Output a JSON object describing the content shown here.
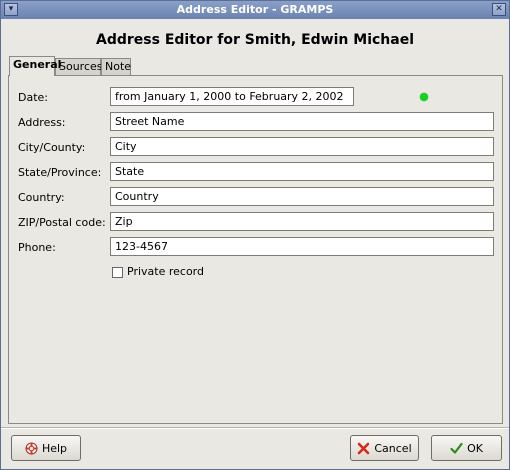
{
  "window": {
    "title": "Address Editor - GRAMPS"
  },
  "heading": "Address Editor for Smith, Edwin Michael",
  "tabs": [
    {
      "label": "General"
    },
    {
      "label": "Sources"
    },
    {
      "label": "Note"
    }
  ],
  "form": {
    "date": {
      "label": "Date:",
      "value": "from  January 1, 2000 to February 2, 2002"
    },
    "address": {
      "label": "Address:",
      "value": "Street Name"
    },
    "city": {
      "label": "City/County:",
      "value": "City"
    },
    "state": {
      "label": "State/Province:",
      "value": "State"
    },
    "country": {
      "label": "Country:",
      "value": "Country"
    },
    "zip": {
      "label": "ZIP/Postal code:",
      "value": "Zip"
    },
    "phone": {
      "label": "Phone:",
      "value": "123-4567"
    },
    "private_record": {
      "label": "Private record",
      "checked": false
    }
  },
  "status": {
    "date_valid_color": "#13d41a"
  },
  "buttons": {
    "help": "Help",
    "cancel": "Cancel",
    "ok": "OK"
  },
  "icons": {
    "help": "lifebuoy-icon",
    "cancel": "red-x-icon",
    "ok": "checkmark-icon"
  }
}
